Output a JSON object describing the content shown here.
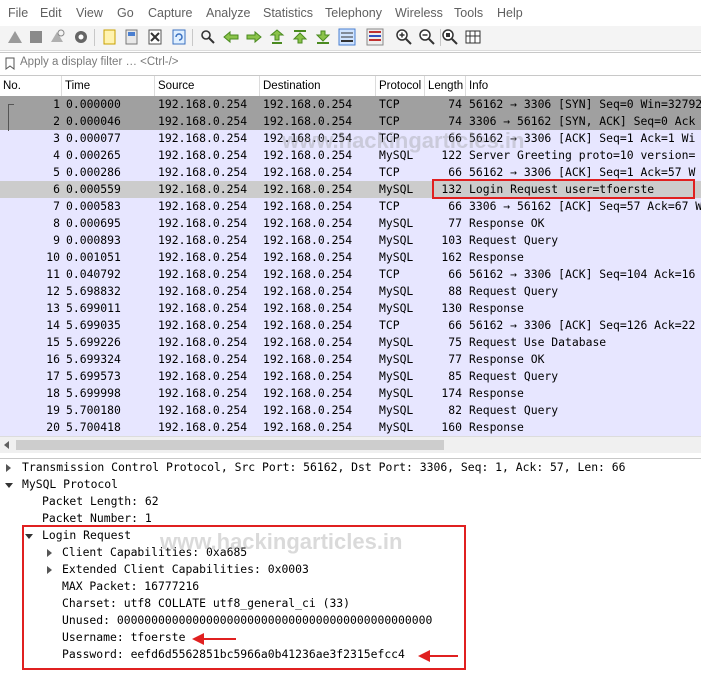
{
  "menu": [
    "File",
    "Edit",
    "View",
    "Go",
    "Capture",
    "Analyze",
    "Statistics",
    "Telephony",
    "Wireless",
    "Tools",
    "Help"
  ],
  "toolbar_icons": [
    "shark-fin-start-icon",
    "stop-icon",
    "restart-icon",
    "options-gear-icon",
    "open-file-icon",
    "save-file-icon",
    "close-file-icon",
    "reload-icon",
    "find-icon",
    "go-back-icon",
    "go-forward-icon",
    "go-to-packet-icon",
    "first-packet-icon",
    "last-packet-icon",
    "autoscroll-icon",
    "colorize-icon",
    "zoom-in-icon",
    "zoom-out-icon",
    "zoom-normal-icon",
    "resize-columns-icon"
  ],
  "filter": {
    "placeholder": "Apply a display filter … <Ctrl-/>"
  },
  "columns": [
    "No.",
    "Time",
    "Source",
    "Destination",
    "Protocol",
    "Length",
    "Info"
  ],
  "packets": [
    {
      "no": "1",
      "time": "0.000000",
      "src": "192.168.0.254",
      "dst": "192.168.0.254",
      "proto": "TCP",
      "len": "74",
      "info": "56162 → 3306 [SYN] Seq=0 Win=32792"
    },
    {
      "no": "2",
      "time": "0.000046",
      "src": "192.168.0.254",
      "dst": "192.168.0.254",
      "proto": "TCP",
      "len": "74",
      "info": "3306 → 56162 [SYN, ACK] Seq=0 Ack"
    },
    {
      "no": "3",
      "time": "0.000077",
      "src": "192.168.0.254",
      "dst": "192.168.0.254",
      "proto": "TCP",
      "len": "66",
      "info": "56162 → 3306 [ACK] Seq=1 Ack=1 Wi"
    },
    {
      "no": "4",
      "time": "0.000265",
      "src": "192.168.0.254",
      "dst": "192.168.0.254",
      "proto": "MySQL",
      "len": "122",
      "info": "Server Greeting proto=10 version="
    },
    {
      "no": "5",
      "time": "0.000286",
      "src": "192.168.0.254",
      "dst": "192.168.0.254",
      "proto": "TCP",
      "len": "66",
      "info": "56162 → 3306 [ACK] Seq=1 Ack=57 W"
    },
    {
      "no": "6",
      "time": "0.000559",
      "src": "192.168.0.254",
      "dst": "192.168.0.254",
      "proto": "MySQL",
      "len": "132",
      "info": "Login Request user=tfoerste"
    },
    {
      "no": "7",
      "time": "0.000583",
      "src": "192.168.0.254",
      "dst": "192.168.0.254",
      "proto": "TCP",
      "len": "66",
      "info": "3306 → 56162 [ACK] Seq=57 Ack=67 W"
    },
    {
      "no": "8",
      "time": "0.000695",
      "src": "192.168.0.254",
      "dst": "192.168.0.254",
      "proto": "MySQL",
      "len": "77",
      "info": "Response OK"
    },
    {
      "no": "9",
      "time": "0.000893",
      "src": "192.168.0.254",
      "dst": "192.168.0.254",
      "proto": "MySQL",
      "len": "103",
      "info": "Request Query"
    },
    {
      "no": "10",
      "time": "0.001051",
      "src": "192.168.0.254",
      "dst": "192.168.0.254",
      "proto": "MySQL",
      "len": "162",
      "info": "Response"
    },
    {
      "no": "11",
      "time": "0.040792",
      "src": "192.168.0.254",
      "dst": "192.168.0.254",
      "proto": "TCP",
      "len": "66",
      "info": "56162 → 3306 [ACK] Seq=104 Ack=16"
    },
    {
      "no": "12",
      "time": "5.698832",
      "src": "192.168.0.254",
      "dst": "192.168.0.254",
      "proto": "MySQL",
      "len": "88",
      "info": "Request Query"
    },
    {
      "no": "13",
      "time": "5.699011",
      "src": "192.168.0.254",
      "dst": "192.168.0.254",
      "proto": "MySQL",
      "len": "130",
      "info": "Response"
    },
    {
      "no": "14",
      "time": "5.699035",
      "src": "192.168.0.254",
      "dst": "192.168.0.254",
      "proto": "TCP",
      "len": "66",
      "info": "56162 → 3306 [ACK] Seq=126 Ack=22"
    },
    {
      "no": "15",
      "time": "5.699226",
      "src": "192.168.0.254",
      "dst": "192.168.0.254",
      "proto": "MySQL",
      "len": "75",
      "info": "Request Use Database"
    },
    {
      "no": "16",
      "time": "5.699324",
      "src": "192.168.0.254",
      "dst": "192.168.0.254",
      "proto": "MySQL",
      "len": "77",
      "info": "Response OK"
    },
    {
      "no": "17",
      "time": "5.699573",
      "src": "192.168.0.254",
      "dst": "192.168.0.254",
      "proto": "MySQL",
      "len": "85",
      "info": "Request Query"
    },
    {
      "no": "18",
      "time": "5.699998",
      "src": "192.168.0.254",
      "dst": "192.168.0.254",
      "proto": "MySQL",
      "len": "174",
      "info": "Response"
    },
    {
      "no": "19",
      "time": "5.700180",
      "src": "192.168.0.254",
      "dst": "192.168.0.254",
      "proto": "MySQL",
      "len": "82",
      "info": "Request Query"
    },
    {
      "no": "20",
      "time": "5.700418",
      "src": "192.168.0.254",
      "dst": "192.168.0.254",
      "proto": "MySQL",
      "len": "160",
      "info": "Response"
    }
  ],
  "colors": {
    "row_default": "#e7e6ff",
    "row_syn": "#a0a0a0",
    "row_selected": "#cccccc",
    "highlight": "#e02020"
  },
  "details": {
    "tcp": "Transmission Control Protocol, Src Port: 56162, Dst Port: 3306, Seq: 1, Ack: 57, Len: 66",
    "mysql": "MySQL Protocol",
    "packet_length": "Packet Length: 62",
    "packet_number": "Packet Number: 1",
    "login_request": "Login Request",
    "client_caps": "Client Capabilities: 0xa685",
    "ext_caps": "Extended Client Capabilities: 0x0003",
    "max_packet": "MAX Packet: 16777216",
    "charset": "Charset: utf8 COLLATE utf8_general_ci (33)",
    "unused": "Unused: 0000000000000000000000000000000000000000000000",
    "username": "Username: tfoerste",
    "password": "Password: eefd6d5562851bc5966a0b41236ae3f2315efcc4"
  },
  "watermark": "www.hackingarticles.in"
}
